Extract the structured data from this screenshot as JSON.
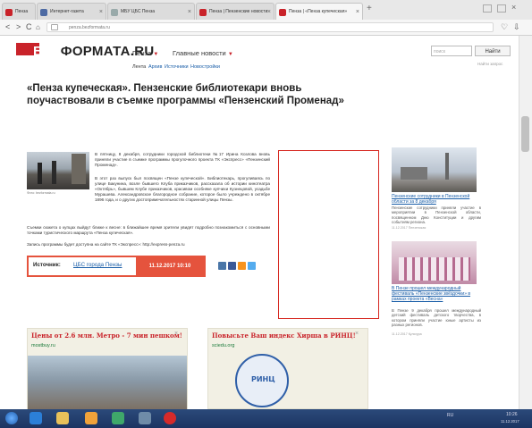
{
  "browser": {
    "tabs": [
      {
        "label": "Пенза"
      },
      {
        "label": "Интернет-газета"
      },
      {
        "label": "МБУ ЦБС Пенза"
      },
      {
        "label": "Пенза | Пензенские новости"
      },
      {
        "label": "Пенза | «Пенза купеческая»"
      }
    ],
    "new_tab": "+",
    "url": "penza.bezformata.ru",
    "nav": {
      "back": "<",
      "forward": ">",
      "reload": "C",
      "home": "⌂"
    }
  },
  "site": {
    "logo_prefix": "БЕЗ",
    "logo_main": "ФОРМАТА.RU",
    "nav": [
      {
        "label": "Пенза"
      },
      {
        "label": "Главные новости"
      }
    ],
    "subnav": [
      "Лента",
      "Архив",
      "Источники",
      "Новостройки"
    ],
    "search_placeholder": "поиск",
    "search_button": "Найти",
    "search_hint": "Найти запрос"
  },
  "article": {
    "title": "«Пенза купеческая». Пензенские библиотекари вновь поучаствовали в съемке программы «Пензенский Променад»",
    "photo_caption": "Фото: bezformata.ru",
    "paragraph1": "В пятницу, 8 декабря, сотрудники городской библиотеки №17 Ирина Козлова вновь приняли участие в съемке программы прогулочного проекта ТК «Экспресс» «Пензенский Променад».",
    "paragraph2": "В этот раз выпуск был посвящен «Пензе купеческой». Библиотекарь, прогуливаясь по улице Бакунина, возле бывшего Клуба приказчиков, рассказала об истории кинотеатра «Октябрь», бывшем Клубе приказчиков, красивом особняке купчихи Кузнецовой, усадьбе Мурашева. Александровское благородное собрание, которое было учреждено в октябре 1896 года, и о других достопримечательностях старинной улицы Пензы.",
    "paragraph3": "Съемки сюжета о купцах выйдут ближе к весне: в ближайшее время зрители увидят подробно познакомиться с основными точками туристического маршрута «Пенза купеческая».",
    "paragraph4": "Запись программы будет доступна на сайте ТК «Экспресс»: http://express-penza.ru",
    "source_label": "Источник:",
    "source_name": "ЦБС города Пензы",
    "date": "11.12.2017  10:10"
  },
  "sidebar": [
    {
      "title": "Пензенские сотрудники в Пензенской области за 8 декабря",
      "text": "Пензенские сотрудники приняли участие в мероприятии в Пензенской области, посвященном Дню Конституции и другим событиям региона.",
      "date": "11.12.2017 Пензенская"
    },
    {
      "title": "В Пензе прошел международный фестиваль «Пензенские звёздочки» в рамках проекта «Весна»",
      "text": "В Пензе 9 декабря прошел международный детский фестиваль детского творчества, в котором приняли участие юные артисты из разных регионов.",
      "date": "11.12.2017 Культура"
    }
  ],
  "cards": [
    {
      "title": "Цены от 2.6 млн. Метро - 7 мин пешком!",
      "source": "mostbuy.ru"
    },
    {
      "title": "Повысьте Ваш индекс Хирша в РИНЦ!",
      "source": "sciedu.org"
    }
  ],
  "cards_badge": "РИНЦ",
  "taskbar": {
    "tray_lang": "RU",
    "tray_time": "10:26",
    "tray_date": "11.12.2017"
  },
  "colors": {
    "accent_red": "#c9232a",
    "source_orange": "#e5533d",
    "link_blue": "#1a5ea8"
  }
}
